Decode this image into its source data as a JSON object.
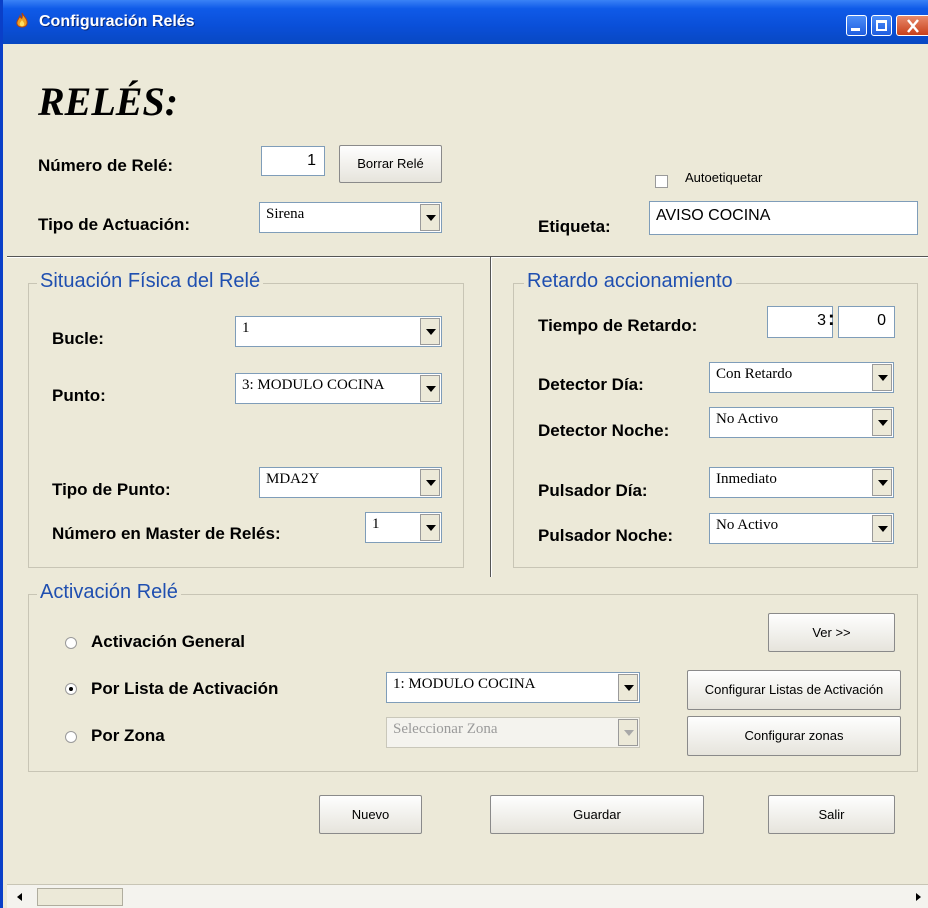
{
  "window": {
    "title": "Configuración Relés",
    "icon": "fire-icon"
  },
  "header": {
    "heading": "RELÉS:"
  },
  "top": {
    "relay_number_label": "Número de Relé:",
    "relay_number_value": "1",
    "delete_button": "Borrar Relé",
    "auto_label_checkbox": "Autoetiquetar",
    "auto_label_checked": false,
    "actuation_type_label": "Tipo de Actuación:",
    "actuation_type_value": "Sirena",
    "tag_label": "Etiqueta:",
    "tag_value": "AVISO COCINA"
  },
  "physical": {
    "legend": "Situación Física del Relé",
    "loop_label": "Bucle:",
    "loop_value": "1",
    "point_label": "Punto:",
    "point_value": "3: MODULO COCINA",
    "point_type_label": "Tipo de Punto:",
    "point_type_value": "MDA2Y",
    "master_label": "Número en Master de Relés:",
    "master_value": "1"
  },
  "delay": {
    "legend": "Retardo accionamiento",
    "delay_time_label": "Tiempo de Retardo:",
    "delay_minutes": "3",
    "delay_separator": ":",
    "delay_seconds": "0",
    "detector_day_label": "Detector Día:",
    "detector_day_value": "Con Retardo",
    "detector_night_label": "Detector Noche:",
    "detector_night_value": "No Activo",
    "button_day_label": "Pulsador Día:",
    "button_day_value": "Inmediato",
    "button_night_label": "Pulsador Noche:",
    "button_night_value": "No Activo"
  },
  "activation": {
    "legend": "Activación Relé",
    "general_label": "Activación General",
    "list_label": "Por Lista de Activación",
    "zone_label": "Por Zona",
    "selected": "list",
    "list_value": "1: MODULO COCINA",
    "zone_placeholder": "Seleccionar Zona",
    "view_button": "Ver >>",
    "config_lists_button": "Configurar Listas de Activación",
    "config_zones_button": "Configurar zonas"
  },
  "footer": {
    "new_button": "Nuevo",
    "save_button": "Guardar",
    "exit_button": "Salir"
  },
  "colors": {
    "titlebar": "#0a4fd8",
    "legend_text": "#1f4fb0",
    "window_bg": "#ece9d8"
  }
}
